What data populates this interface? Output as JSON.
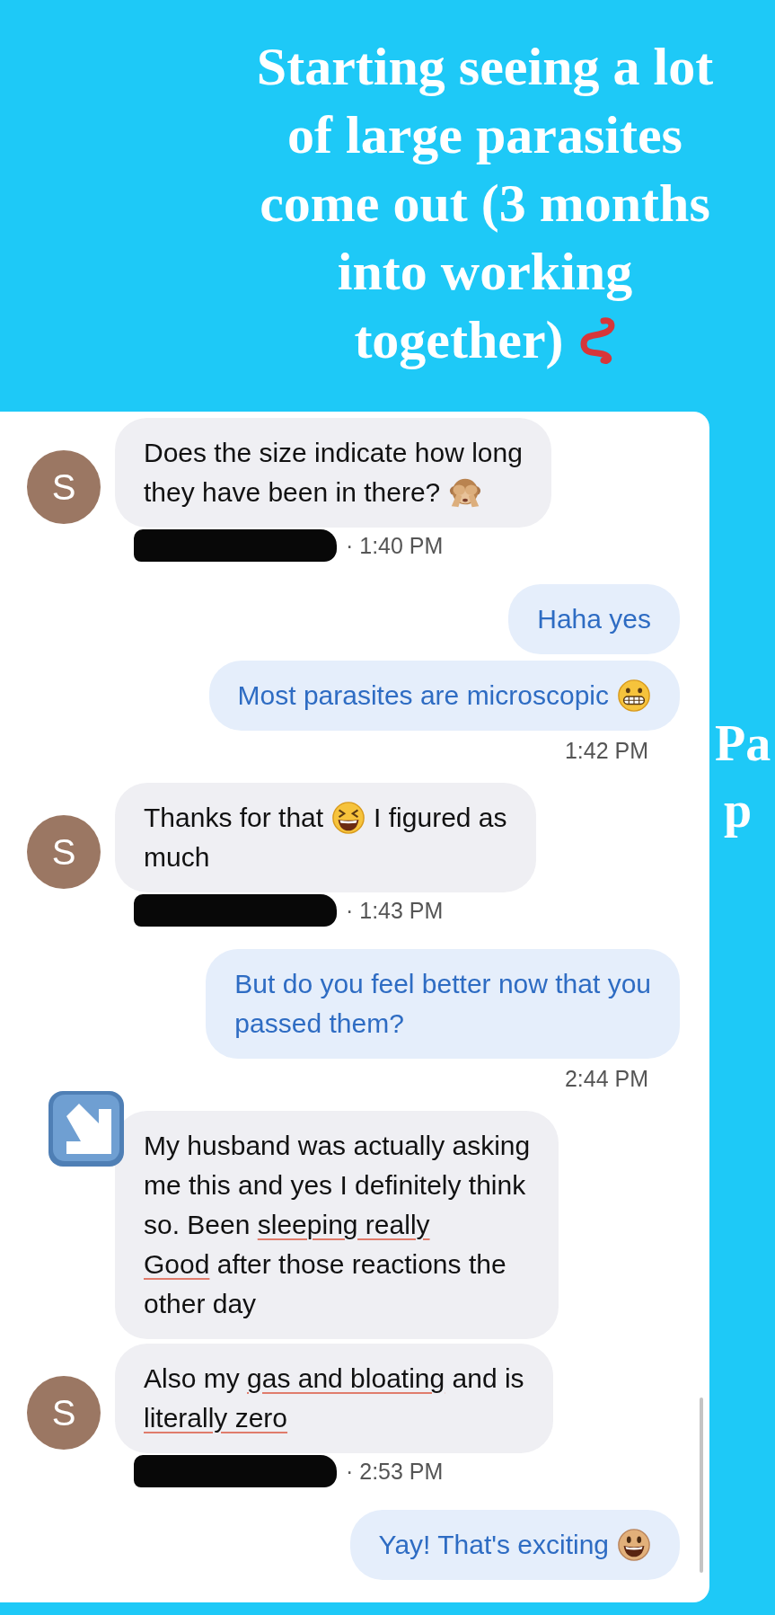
{
  "title": {
    "segments": [
      {
        "kind": "text",
        "text": "Starting seeing a lot\nof large parasites\ncome out (3 months\ninto working"
      },
      {
        "kind": "break"
      },
      {
        "kind": "text",
        "text": "together)"
      },
      {
        "kind": "emoji"
      }
    ]
  },
  "side_caption": {
    "lines": [
      "Pa",
      "p"
    ]
  },
  "messages": [
    {
      "kind": "incoming",
      "avatar": {
        "kind": "letter",
        "letter": "S"
      },
      "segments": [
        {
          "kind": "text",
          "text": "Does the size indicate how long",
          "marked": false
        },
        {
          "kind": "break"
        },
        {
          "kind": "text",
          "text": "they have been in there?",
          "marked": false
        },
        {
          "kind": "emoji"
        }
      ]
    },
    {
      "kind": "meta",
      "redacted": true,
      "time": "· 1:40 PM"
    },
    {
      "kind": "outgoing",
      "segments": [
        {
          "kind": "text",
          "text": "Haha yes",
          "marked": false
        }
      ]
    },
    {
      "kind": "outgoing",
      "segments": [
        {
          "kind": "text",
          "text": "Most parasites are microscopic",
          "marked": false
        },
        {
          "kind": "emoji"
        }
      ]
    },
    {
      "kind": "time",
      "time": "1:42 PM"
    },
    {
      "kind": "incoming",
      "avatar": {
        "kind": "letter",
        "letter": "S"
      },
      "segments": [
        {
          "kind": "text",
          "text": "Thanks for that",
          "marked": false
        },
        {
          "kind": "emoji"
        },
        {
          "kind": "text",
          "text": "I figured as",
          "marked": false
        },
        {
          "kind": "break"
        },
        {
          "kind": "text",
          "text": "much",
          "marked": false
        }
      ]
    },
    {
      "kind": "meta",
      "redacted": true,
      "time": "· 1:43 PM"
    },
    {
      "kind": "outgoing",
      "segments": [
        {
          "kind": "text",
          "text": "But do you feel better now that you\npassed them?",
          "marked": false
        }
      ]
    },
    {
      "kind": "time",
      "time": "2:44 PM"
    },
    {
      "kind": "incoming",
      "avatar": {
        "kind": "icon"
      },
      "segments": [
        {
          "kind": "text",
          "text": "My husband was actually asking\nme this and yes I definitely think\nso. Been ",
          "marked": false
        },
        {
          "kind": "text",
          "text": "sleeping really",
          "marked": true
        },
        {
          "kind": "text",
          "text": "\nGood",
          "marked": true
        },
        {
          "kind": "text",
          "text": " after those reactions the\nother day",
          "marked": false
        }
      ]
    },
    {
      "kind": "incoming",
      "avatar": {
        "kind": "letter",
        "letter": "S"
      },
      "segments": [
        {
          "kind": "text",
          "text": "Also my ",
          "marked": false
        },
        {
          "kind": "text",
          "text": "gas and bloating",
          "marked": true
        },
        {
          "kind": "text",
          "text": " and is\n",
          "marked": false
        },
        {
          "kind": "text",
          "text": "literally zero",
          "marked": true
        }
      ]
    },
    {
      "kind": "meta",
      "redacted": true,
      "time": "· 2:53 PM"
    },
    {
      "kind": "outgoing",
      "segments": [
        {
          "kind": "text",
          "text": "Yay! That's exciting",
          "marked": false
        },
        {
          "kind": "emoji"
        }
      ]
    }
  ]
}
